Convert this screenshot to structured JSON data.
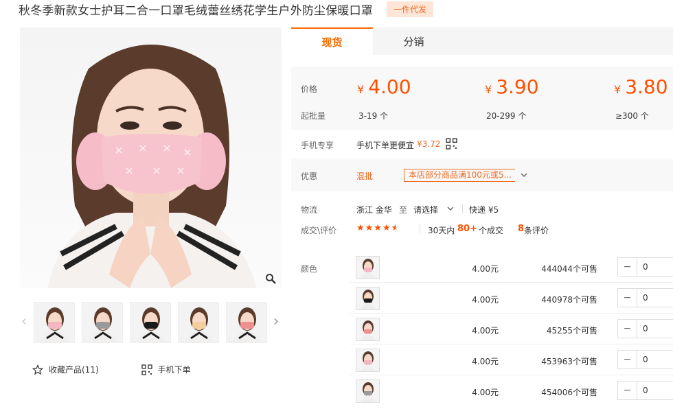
{
  "product": {
    "title": "秋冬季新款女士护耳二合一口罩毛绒蕾丝绣花学生户外防尘保暖口罩",
    "tag": "一件代发"
  },
  "gallery": {
    "main_image": "woman-wearing-pink-ear-muff-mask",
    "thumbnails": [
      {
        "color": "#f4b6c2",
        "icon": "pink-mask-thumb"
      },
      {
        "color": "#9a9a9a",
        "icon": "gray-mask-thumb"
      },
      {
        "color": "#1a1a1a",
        "icon": "black-mask-thumb"
      },
      {
        "color": "#f2cf9c",
        "icon": "beige-mask-thumb"
      },
      {
        "color": "#ef8f8f",
        "icon": "coral-mask-thumb"
      }
    ]
  },
  "actions": {
    "favorite": "收藏产品(11)",
    "mobile_order": "手机下单"
  },
  "tabs": [
    {
      "label": "现货",
      "active": true
    },
    {
      "label": "分销",
      "active": false
    }
  ],
  "pricing": {
    "price_label": "价格",
    "moq_label": "起批量",
    "currency": "¥",
    "tiers": [
      {
        "price": "4.00",
        "range": "3-19 个"
      },
      {
        "price": "3.90",
        "range": "20-299 个"
      },
      {
        "price": "3.80",
        "range": "≥300 个"
      }
    ]
  },
  "mobile": {
    "label": "手机专享",
    "text": "手机下单更便宜",
    "price": "¥3.72"
  },
  "promo": {
    "label": "优惠",
    "mix": "混批",
    "offer": "本店部分商品满100元或5..."
  },
  "logistics": {
    "label": "物流",
    "origin": "浙江 金华",
    "to": "至",
    "destination": "请选择",
    "shipping": "快递 ¥5"
  },
  "reviews": {
    "label": "成交\\评价",
    "rating": 4.5,
    "period": "30天内",
    "deals": "80+",
    "deals_suffix": "个成交",
    "review_count": "8",
    "review_suffix": "条评价"
  },
  "sku": {
    "label": "颜色",
    "rows": [
      {
        "price": "4.00元",
        "stock": "444044个可售",
        "qty": "0",
        "color": "#f4b6c2"
      },
      {
        "price": "4.00元",
        "stock": "440978个可售",
        "qty": "0",
        "color": "#1a1a1a"
      },
      {
        "price": "4.00元",
        "stock": "45255个可售",
        "qty": "0",
        "color": "#ef8f8f"
      },
      {
        "price": "4.00元",
        "stock": "453963个可售",
        "qty": "0",
        "color": "#f4b6c2"
      },
      {
        "price": "4.00元",
        "stock": "454006个可售",
        "qty": "0",
        "color": "#9a9a9a"
      }
    ]
  },
  "colors": {
    "accent": "#ff5000",
    "tab_accent": "#ff6a00",
    "tag_bg": "#fde6d7"
  }
}
